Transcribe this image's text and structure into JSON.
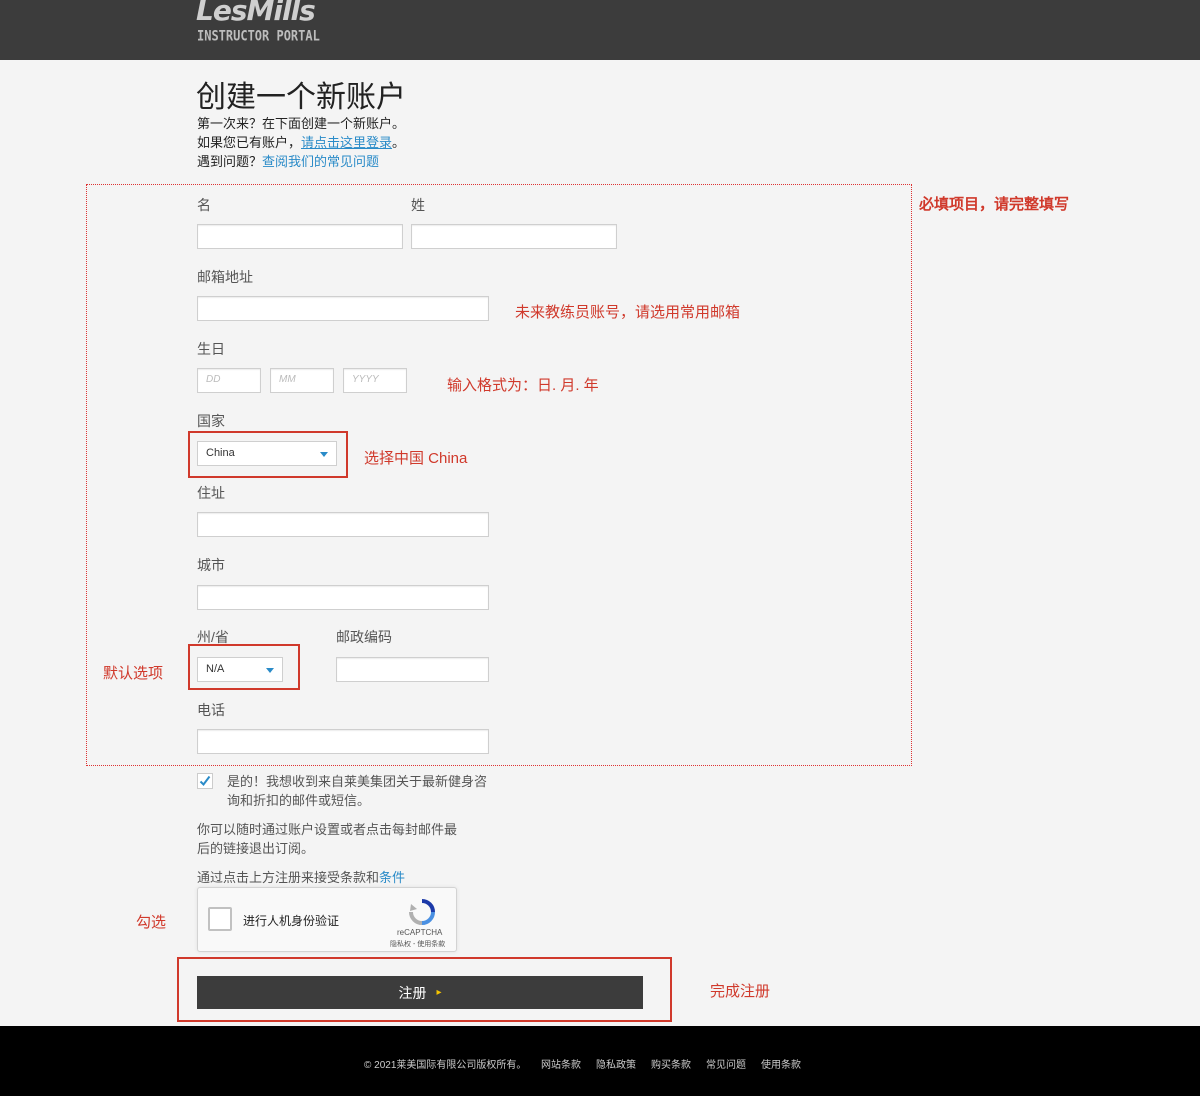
{
  "header": {
    "logo_main": "LesMills",
    "logo_sub": "INSTRUCTOR PORTAL"
  },
  "page": {
    "title": "创建一个新账户",
    "line1": "第一次来？在下面创建一个新账户。",
    "line2_prefix": "如果您已有账户，",
    "line2_link": "请点击这里登录",
    "line2_suffix": "。",
    "line3_prefix": "遇到问题？",
    "line3_link": "查阅我们的常见问题"
  },
  "form": {
    "first_name_label": "名",
    "last_name_label": "姓",
    "first_name_value": "",
    "last_name_value": "",
    "email_label": "邮箱地址",
    "email_value": "",
    "birthday_label": "生日",
    "dd_placeholder": "DD",
    "mm_placeholder": "MM",
    "yyyy_placeholder": "YYYY",
    "country_label": "国家",
    "country_value": "China",
    "address_label": "住址",
    "address_value": "",
    "city_label": "城市",
    "city_value": "",
    "state_label": "州/省",
    "state_value": "N/A",
    "postcode_label": "邮政编码",
    "postcode_value": "",
    "phone_label": "电话",
    "phone_value": "",
    "newsletter_checked": true,
    "newsletter_line1": "是的！我想收到来自莱美集团关于最新健身咨",
    "newsletter_line2": "询和折扣的邮件或短信。",
    "unsub_line1": "你可以随时通过账户设置或者点击每封邮件最",
    "unsub_line2": "后的链接退出订阅。",
    "terms_prefix": "通过点击上方注册来接受条款和",
    "terms_link": "条件",
    "recaptcha_label": "进行人机身份验证",
    "recaptcha_brand": "reCAPTCHA",
    "recaptcha_terms": "隐私权 - 使用条款",
    "submit_label": "注册",
    "submit_arrow": "▸"
  },
  "annotations": {
    "required": "必填项目，请完整填写",
    "email_note": "未来教练员账号，请选用常用邮箱",
    "dob_note": "输入格式为：日. 月. 年",
    "country_note": "选择中国 China",
    "state_note": "默认选项",
    "captcha_note": "勾选",
    "submit_note": "完成注册"
  },
  "footer": {
    "copyright": "© 2021莱美国际有限公司版权所有。",
    "links": [
      "网站条款",
      "隐私政策",
      "购买条款",
      "常见问题",
      "使用条款"
    ]
  },
  "colors": {
    "header_bg": "#3c3c3c",
    "link": "#2a8bc8",
    "annotation_red": "#d0392b",
    "footer_bg": "#000000"
  }
}
